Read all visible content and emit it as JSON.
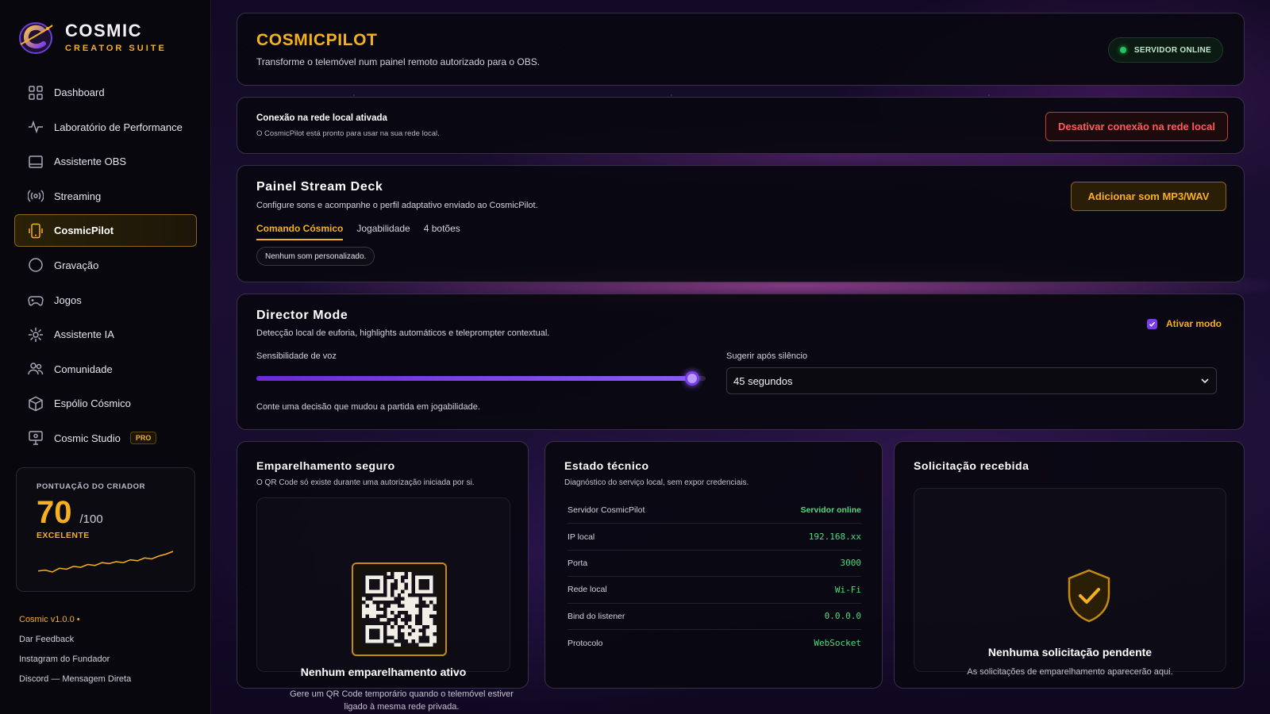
{
  "brand": {
    "title": "COSMIC",
    "subtitle": "CREATOR SUITE"
  },
  "sidebar": {
    "items": [
      {
        "label": "Dashboard",
        "icon": "grid-icon"
      },
      {
        "label": "Laboratório de Performance",
        "icon": "pulse-icon"
      },
      {
        "label": "Assistente OBS",
        "icon": "window-icon"
      },
      {
        "label": "Streaming",
        "icon": "broadcast-icon"
      },
      {
        "label": "CosmicPilot",
        "icon": "phone-icon",
        "active": true
      },
      {
        "label": "Gravação",
        "icon": "record-circle-icon"
      },
      {
        "label": "Jogos",
        "icon": "gamepad-icon"
      },
      {
        "label": "Assistente IA",
        "icon": "sparkle-icon"
      },
      {
        "label": "Comunidade",
        "icon": "users-icon"
      },
      {
        "label": "Espólio Cósmico",
        "icon": "box-icon"
      },
      {
        "label": "Cosmic Studio",
        "icon": "monitor-icon",
        "badge": "PRO"
      }
    ],
    "score": {
      "label": "PONTUAÇÃO DO CRIADOR",
      "value": "70",
      "max": "/100",
      "grade": "EXCELENTE",
      "trend": [
        4,
        5,
        3,
        7,
        6,
        9,
        8,
        11,
        10,
        13,
        12,
        14,
        13,
        16,
        15,
        18,
        17,
        20,
        22,
        25
      ]
    },
    "footer": {
      "version": "Cosmic v1.0.0 •",
      "links": [
        "Dar Feedback",
        "Instagram do Fundador",
        "Discord — Mensagem Direta"
      ]
    }
  },
  "header": {
    "title": "COSMICPILOT",
    "subtitle": "Transforme o telemóvel num painel remoto autorizado para o OBS.",
    "status": "SERVIDOR ONLINE"
  },
  "lan": {
    "title": "Conexão na rede local ativada",
    "subtitle": "O CosmicPilot está pronto para usar na sua rede local.",
    "button": "Desativar conexão na rede local"
  },
  "deck": {
    "title": "Painel Stream Deck",
    "subtitle": "Configure sons e acompanhe o perfil adaptativo enviado ao CosmicPilot.",
    "button": "Adicionar som MP3/WAV",
    "tabs": [
      "Comando Cósmico",
      "Jogabilidade",
      "4 botões"
    ],
    "chip": "Nenhum som personalizado."
  },
  "director": {
    "title": "Director Mode",
    "subtitle": "Detecção local de euforia, highlights automáticos e teleprompter contextual.",
    "toggle_label": "Ativar modo",
    "enabled": true,
    "slider_label": "Sensibilidade de voz",
    "slider_value": 0.97,
    "select_label": "Sugerir após silêncio",
    "select_value": "45 segundos",
    "hint": "Conte uma decisão que mudou a partida em jogabilidade."
  },
  "pairing": {
    "title": "Emparelhamento seguro",
    "subtitle": "O QR Code só existe durante uma autorização iniciada por si.",
    "heading": "Nenhum emparelhamento ativo",
    "text": "Gere um QR Code temporário quando o telemóvel estiver ligado à mesma rede privada."
  },
  "tech": {
    "title": "Estado técnico",
    "subtitle": "Diagnóstico do serviço local, sem expor credenciais.",
    "rows": [
      {
        "key": "Servidor CosmicPilot",
        "value": "Servidor online"
      },
      {
        "key": "IP local",
        "value": "192.168.xx"
      },
      {
        "key": "Porta",
        "value": "3000"
      },
      {
        "key": "Rede local",
        "value": "Wi-Fi"
      },
      {
        "key": "Bind do listener",
        "value": "0.0.0.0"
      },
      {
        "key": "Protocolo",
        "value": "WebSocket"
      }
    ]
  },
  "request": {
    "title": "Solicitação recebida",
    "heading": "Nenhuma solicitação pendente",
    "text": "As solicitações de emparelhamento aparecerão aqui."
  },
  "colors": {
    "accent": "#f5b01f",
    "success": "#22c55e",
    "danger": "#ff5a5a",
    "purple": "#7c3aed"
  }
}
